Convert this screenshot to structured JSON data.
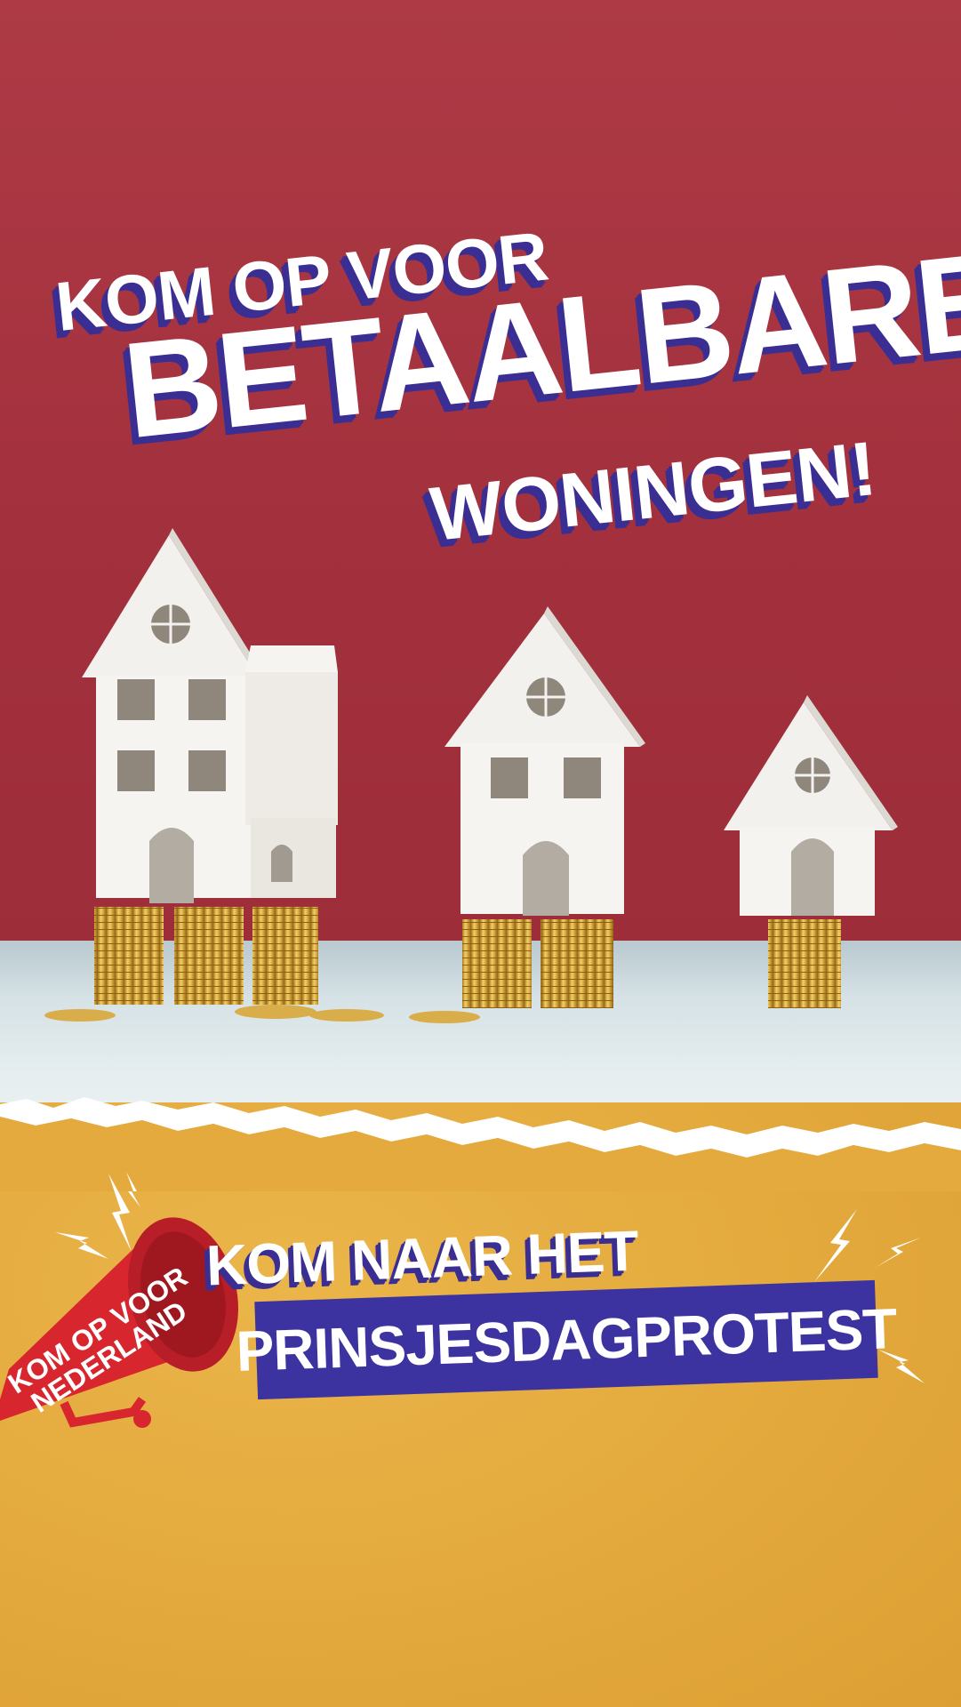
{
  "headline": {
    "line1": "KOM OP VOOR",
    "line2": "BETAALBARE",
    "line3": "WONINGEN!"
  },
  "cta": {
    "line1": "KOM NAAR HET",
    "line2": "PRINSJESDAGPROTEST"
  },
  "logo": {
    "line1": "KOM OP VOOR",
    "line2": "NEDERLAND"
  },
  "colors": {
    "background_top": "#a8323d",
    "background_bottom": "#e4aa3d",
    "headline_shadow": "#3a2e93",
    "banner": "#3c33a0",
    "megaphone": "#d8262f"
  },
  "icons": [
    "house-icon",
    "coin-stack-icon",
    "megaphone-icon",
    "lightning-icon"
  ]
}
